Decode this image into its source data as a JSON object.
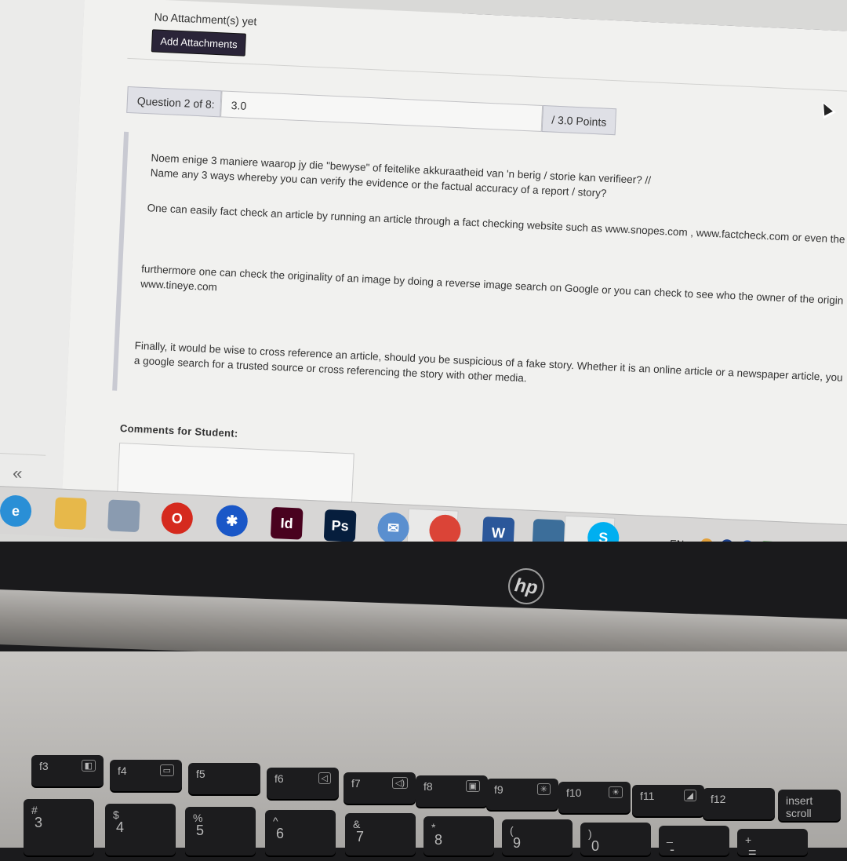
{
  "form": {
    "attachment_status": "No Attachment(s) yet",
    "add_attachments_label": "Add Attachments",
    "question_label": "Question 2 of 8:",
    "score_value": "3.0",
    "points_label": "/ 3.0 Points",
    "comments_label": "Comments for Student:",
    "collapse_glyph": "«"
  },
  "question": {
    "line1": "Noem enige 3 maniere waarop jy die \"bewyse\" of feitelike akkuraatheid van 'n berig / storie kan verifieer? //",
    "line2": "Name any 3 ways whereby you can verify the evidence or the factual accuracy of a report / story?"
  },
  "answer": {
    "p1": "One can easily fact check an article by running an article through a fact checking website such as www.snopes.com , www.factcheck.com or even the",
    "p2a": "furthermore one can check the originality of an image by doing a reverse image search on Google or you can check to see who the owner of the origin",
    "p2b": "www.tineye.com",
    "p3a": "Finally, it would be wise to cross reference an article, should you be suspicious of a fake story. Whether it is an online article or a newspaper article, you",
    "p3b": "a google search for a trusted source or cross referencing the story with other media."
  },
  "taskbar": {
    "apps": [
      {
        "name": "internet-explorer-icon",
        "glyph": "e",
        "color": "#2a8fd6"
      },
      {
        "name": "file-explorer-icon",
        "glyph": "",
        "color": "#e7b84a"
      },
      {
        "name": "calculator-icon",
        "glyph": "",
        "color": "#8a9bb0"
      },
      {
        "name": "opera-icon",
        "glyph": "O",
        "color": "#d52a1e"
      },
      {
        "name": "bluetooth-icon",
        "glyph": "✱",
        "color": "#1a57c7"
      },
      {
        "name": "indesign-icon",
        "glyph": "Id",
        "color": "#49021f"
      },
      {
        "name": "photoshop-icon",
        "glyph": "Ps",
        "color": "#061e3d"
      },
      {
        "name": "mail-icon",
        "glyph": "✉",
        "color": "#5a8fcf"
      },
      {
        "name": "chrome-icon",
        "glyph": "",
        "color": "#db4437"
      },
      {
        "name": "word-icon",
        "glyph": "W",
        "color": "#2b579a"
      },
      {
        "name": "castle-app-icon",
        "glyph": "",
        "color": "#3c6e9a"
      },
      {
        "name": "skype-icon",
        "glyph": "S",
        "color": "#00aff0"
      }
    ],
    "language": "EN",
    "tray_letter": "V"
  },
  "laptop": {
    "brand": "hp"
  },
  "keyboard": {
    "function_keys": [
      {
        "label": "f3",
        "icon": "◧"
      },
      {
        "label": "f4",
        "icon": "▭"
      },
      {
        "label": "f5",
        "icon": ""
      },
      {
        "label": "f6",
        "icon": "◁"
      },
      {
        "label": "f7",
        "icon": "◁)"
      },
      {
        "label": "f8",
        "icon": "▣"
      },
      {
        "label": "f9",
        "icon": "✳"
      },
      {
        "label": "f10",
        "icon": "☀"
      },
      {
        "label": "f11",
        "icon": "◢"
      },
      {
        "label": "f12",
        "icon": ""
      },
      {
        "label": "insert scroll",
        "icon": ""
      }
    ],
    "number_keys": [
      {
        "top": "#",
        "bottom": "3"
      },
      {
        "top": "$",
        "bottom": "4"
      },
      {
        "top": "%",
        "bottom": "5"
      },
      {
        "top": "^",
        "bottom": "6"
      },
      {
        "top": "&",
        "bottom": "7"
      },
      {
        "top": "*",
        "bottom": "8"
      },
      {
        "top": "(",
        "bottom": "9"
      },
      {
        "top": ")",
        "bottom": "0"
      },
      {
        "top": "_",
        "bottom": "-"
      },
      {
        "top": "+",
        "bottom": "="
      }
    ]
  }
}
